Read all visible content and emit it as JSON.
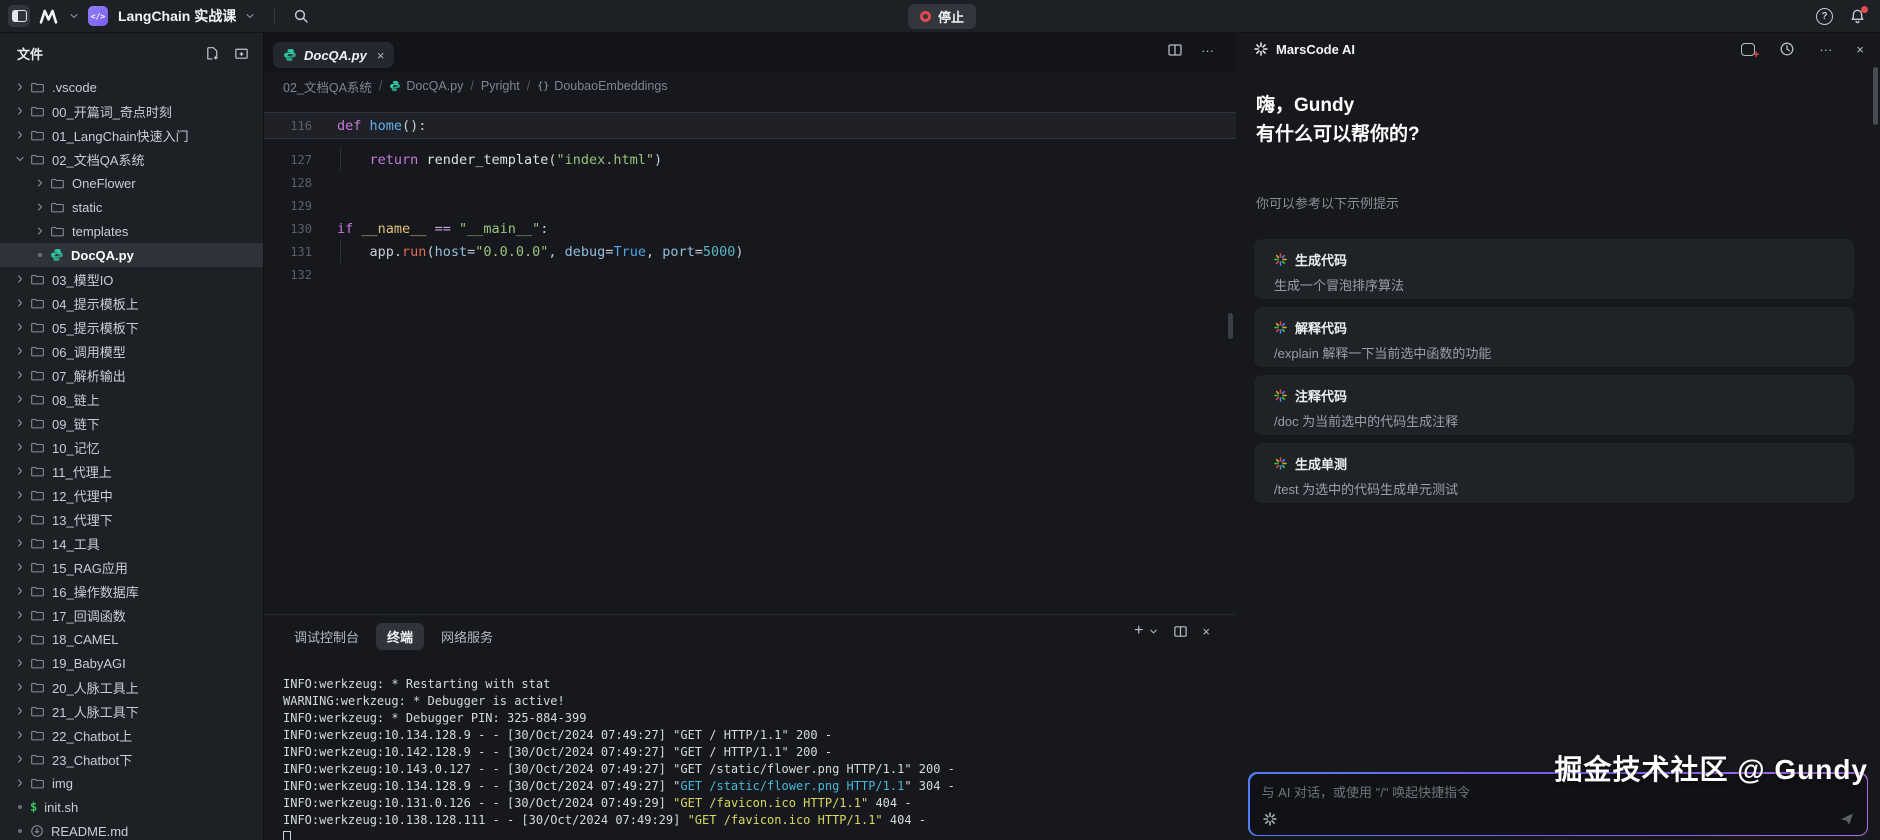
{
  "topbar": {
    "workspace": "LangChain 实战课",
    "stop": "停止"
  },
  "sidebar": {
    "header": "文件",
    "items": [
      {
        "l": ".vscode",
        "d": 0,
        "k": "folder",
        "c": "r"
      },
      {
        "l": "00_开篇词_奇点时刻",
        "d": 0,
        "k": "folder",
        "c": "r"
      },
      {
        "l": "01_LangChain快速入门",
        "d": 0,
        "k": "folder",
        "c": "r"
      },
      {
        "l": "02_文档QA系统",
        "d": 0,
        "k": "folder",
        "c": "d"
      },
      {
        "l": "OneFlower",
        "d": 1,
        "k": "folder",
        "c": "r"
      },
      {
        "l": "static",
        "d": 1,
        "k": "folder",
        "c": "r"
      },
      {
        "l": "templates",
        "d": 1,
        "k": "folder",
        "c": "r"
      },
      {
        "l": "DocQA.py",
        "d": 1,
        "k": "python",
        "dot": true,
        "sel": true
      },
      {
        "l": "03_模型IO",
        "d": 0,
        "k": "folder",
        "c": "r"
      },
      {
        "l": "04_提示模板上",
        "d": 0,
        "k": "folder",
        "c": "r"
      },
      {
        "l": "05_提示模板下",
        "d": 0,
        "k": "folder",
        "c": "r"
      },
      {
        "l": "06_调用模型",
        "d": 0,
        "k": "folder",
        "c": "r"
      },
      {
        "l": "07_解析输出",
        "d": 0,
        "k": "folder",
        "c": "r"
      },
      {
        "l": "08_链上",
        "d": 0,
        "k": "folder",
        "c": "r"
      },
      {
        "l": "09_链下",
        "d": 0,
        "k": "folder",
        "c": "r"
      },
      {
        "l": "10_记忆",
        "d": 0,
        "k": "folder",
        "c": "r"
      },
      {
        "l": "11_代理上",
        "d": 0,
        "k": "folder",
        "c": "r"
      },
      {
        "l": "12_代理中",
        "d": 0,
        "k": "folder",
        "c": "r"
      },
      {
        "l": "13_代理下",
        "d": 0,
        "k": "folder",
        "c": "r"
      },
      {
        "l": "14_工具",
        "d": 0,
        "k": "folder",
        "c": "r"
      },
      {
        "l": "15_RAG应用",
        "d": 0,
        "k": "folder",
        "c": "r"
      },
      {
        "l": "16_操作数据库",
        "d": 0,
        "k": "folder",
        "c": "r"
      },
      {
        "l": "17_回调函数",
        "d": 0,
        "k": "folder",
        "c": "r"
      },
      {
        "l": "18_CAMEL",
        "d": 0,
        "k": "folder",
        "c": "r"
      },
      {
        "l": "19_BabyAGI",
        "d": 0,
        "k": "folder",
        "c": "r"
      },
      {
        "l": "20_人脉工具上",
        "d": 0,
        "k": "folder",
        "c": "r"
      },
      {
        "l": "21_人脉工具下",
        "d": 0,
        "k": "folder",
        "c": "r"
      },
      {
        "l": "22_Chatbot上",
        "d": 0,
        "k": "folder",
        "c": "r"
      },
      {
        "l": "23_Chatbot下",
        "d": 0,
        "k": "folder",
        "c": "r"
      },
      {
        "l": "img",
        "d": 0,
        "k": "folder",
        "c": "r"
      },
      {
        "l": "init.sh",
        "d": 0,
        "k": "shell",
        "dot": true
      },
      {
        "l": "README.md",
        "d": 0,
        "k": "markdown",
        "dot": true
      }
    ]
  },
  "editor": {
    "tab": "DocQA.py",
    "breadcrumbs": [
      {
        "label": "02_文档QA系统"
      },
      {
        "label": "DocQA.py",
        "icon": "python"
      },
      {
        "label": "Pyright"
      },
      {
        "label": "DoubaoEmbeddings",
        "icon": "symbol"
      }
    ],
    "lines": [
      {
        "num": "116",
        "sticky": true,
        "tokens": [
          [
            "def",
            "kw"
          ],
          [
            " ",
            "pl"
          ],
          [
            "home",
            "fn"
          ],
          [
            "():",
            "pl"
          ]
        ]
      },
      {
        "num": "127",
        "ind": true,
        "tokens": [
          [
            "    ",
            "pl"
          ],
          [
            "return",
            "kw"
          ],
          [
            " ",
            "pl"
          ],
          [
            "render_template",
            "call"
          ],
          [
            "(",
            "pl"
          ],
          [
            "\"index.html\"",
            "str"
          ],
          [
            ")",
            "pl"
          ]
        ]
      },
      {
        "num": "128",
        "tokens": []
      },
      {
        "num": "129",
        "tokens": []
      },
      {
        "num": "130",
        "tokens": [
          [
            "if",
            "kw"
          ],
          [
            " ",
            "pl"
          ],
          [
            "__name__",
            "dunder"
          ],
          [
            " ",
            "pl"
          ],
          [
            "==",
            "op"
          ],
          [
            " ",
            "pl"
          ],
          [
            "\"__main__\"",
            "str"
          ],
          [
            ":",
            "pl"
          ]
        ]
      },
      {
        "num": "131",
        "ind": true,
        "tokens": [
          [
            "    ",
            "pl"
          ],
          [
            "app",
            "pl"
          ],
          [
            ".",
            "pl"
          ],
          [
            "run",
            "meth"
          ],
          [
            "(",
            "pl"
          ],
          [
            "host",
            "param"
          ],
          [
            "=",
            "pl"
          ],
          [
            "\"0.0.0.0\"",
            "str"
          ],
          [
            ",",
            "pl"
          ],
          [
            " ",
            "pl"
          ],
          [
            "debug",
            "param"
          ],
          [
            "=",
            "pl"
          ],
          [
            "True",
            "bool"
          ],
          [
            ",",
            "pl"
          ],
          [
            " ",
            "pl"
          ],
          [
            "port",
            "param"
          ],
          [
            "=",
            "pl"
          ],
          [
            "5000",
            "num"
          ],
          [
            ")",
            "pl"
          ]
        ]
      },
      {
        "num": "132",
        "tokens": []
      }
    ]
  },
  "terminal": {
    "tabs": [
      {
        "label": "调试控制台",
        "active": false
      },
      {
        "label": "终端",
        "active": true
      },
      {
        "label": "网络服务",
        "active": false
      }
    ],
    "lines": [
      [
        [
          "INFO:werkzeug: * Restarting with stat",
          "t-fg"
        ]
      ],
      [
        [
          "WARNING:werkzeug: * Debugger is active!",
          "t-fg"
        ]
      ],
      [
        [
          "INFO:werkzeug: * Debugger PIN: 325-884-399",
          "t-fg"
        ]
      ],
      [
        [
          "INFO:werkzeug:10.134.128.9 - - [30/Oct/2024 07:49:27] \"GET / HTTP/1.1\" 200 -",
          "t-fg"
        ]
      ],
      [
        [
          "INFO:werkzeug:10.142.128.9 - - [30/Oct/2024 07:49:27] \"GET / HTTP/1.1\" 200 -",
          "t-fg"
        ]
      ],
      [
        [
          "INFO:werkzeug:10.143.0.127 - - [30/Oct/2024 07:49:27] \"GET /static/flower.png HTTP/1.1\" 200 -",
          "t-fg"
        ]
      ],
      [
        [
          "INFO:werkzeug:10.134.128.9 - - [30/Oct/2024 07:49:27] \"",
          "t-fg"
        ],
        [
          "GET /static/flower.png HTTP/1.1",
          "t-cyan"
        ],
        [
          "\" 304 -",
          "t-fg"
        ]
      ],
      [
        [
          "INFO:werkzeug:10.131.0.126 - - [30/Oct/2024 07:49:29] ",
          "t-fg"
        ],
        [
          "\"GET /favicon.ico HTTP/1.1\"",
          "t-yellow"
        ],
        [
          " 404 -",
          "t-fg"
        ]
      ],
      [
        [
          "INFO:werkzeug:10.138.128.111 - - [30/Oct/2024 07:49:29] ",
          "t-fg"
        ],
        [
          "\"GET /favicon.ico HTTP/1.1\"",
          "t-yellow"
        ],
        [
          " 404 -",
          "t-fg"
        ]
      ]
    ]
  },
  "assistant": {
    "title": "MarsCode AI",
    "greeting1": "嗨，Gundy",
    "greeting2": "有什么可以帮你的?",
    "hint": "你可以参考以下示例提示",
    "cards": [
      {
        "title": "生成代码",
        "desc": "生成一个冒泡排序算法"
      },
      {
        "title": "解释代码",
        "desc": "/explain 解释一下当前选中函数的功能"
      },
      {
        "title": "注释代码",
        "desc": "/doc 为当前选中的代码生成注释"
      },
      {
        "title": "生成单测",
        "desc": "/test 为选中的代码生成单元测试"
      }
    ],
    "placeholder": "与 AI 对话，或使用 \"/\" 唤起快捷指令"
  },
  "watermark": "掘金技术社区 @ Gundy",
  "colors": {
    "accent_purple": "#8573f0",
    "stop_red": "#e5484d",
    "python_teal": "#2fc5a2",
    "input_gradient_start": "#4f7df7",
    "input_gradient_end": "#b26bf0"
  }
}
